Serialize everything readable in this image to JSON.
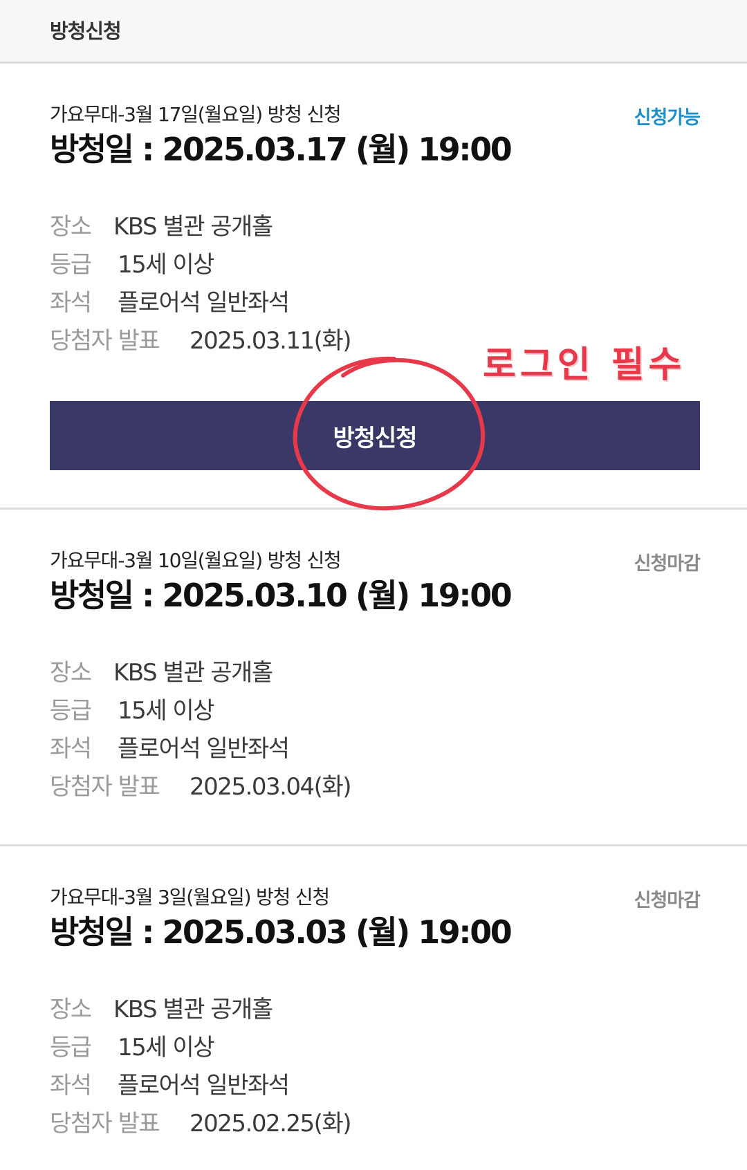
{
  "header": {
    "title": "방청신청"
  },
  "cards": [
    {
      "subtitle": "가요무대-3월 17일(월요일) 방청 신청",
      "showdate": "방청일 : 2025.03.17 (월) 19:00",
      "status": "신청가능",
      "place_label": "장소",
      "place": "KBS 별관 공개홀",
      "grade_label": "등급",
      "grade": "15세 이상",
      "seat_label": "좌석",
      "seat": "플로어석 일반좌석",
      "winner_label": "당첨자 발표",
      "winner": "2025.03.11(화)",
      "button": "방청신청"
    },
    {
      "subtitle": "가요무대-3월 10일(월요일) 방청 신청",
      "showdate": "방청일 : 2025.03.10 (월) 19:00",
      "status": "신청마감",
      "place_label": "장소",
      "place": "KBS 별관 공개홀",
      "grade_label": "등급",
      "grade": "15세 이상",
      "seat_label": "좌석",
      "seat": "플로어석 일반좌석",
      "winner_label": "당첨자 발표",
      "winner": "2025.03.04(화)"
    },
    {
      "subtitle": "가요무대-3월 3일(월요일) 방청 신청",
      "showdate": "방청일 : 2025.03.03 (월) 19:00",
      "status": "신청마감",
      "place_label": "장소",
      "place": "KBS 별관 공개홀",
      "grade_label": "등급",
      "grade": "15세 이상",
      "seat_label": "좌석",
      "seat": "플로어석 일반좌석",
      "winner_label": "당첨자 발표",
      "winner": "2025.02.25(화)"
    }
  ],
  "annotation": {
    "text": "로그인 필수",
    "color": "#e8394a"
  },
  "colors": {
    "button_bg": "#393866",
    "status_open": "#1e8fc6",
    "status_closed": "#8a8a8a"
  }
}
